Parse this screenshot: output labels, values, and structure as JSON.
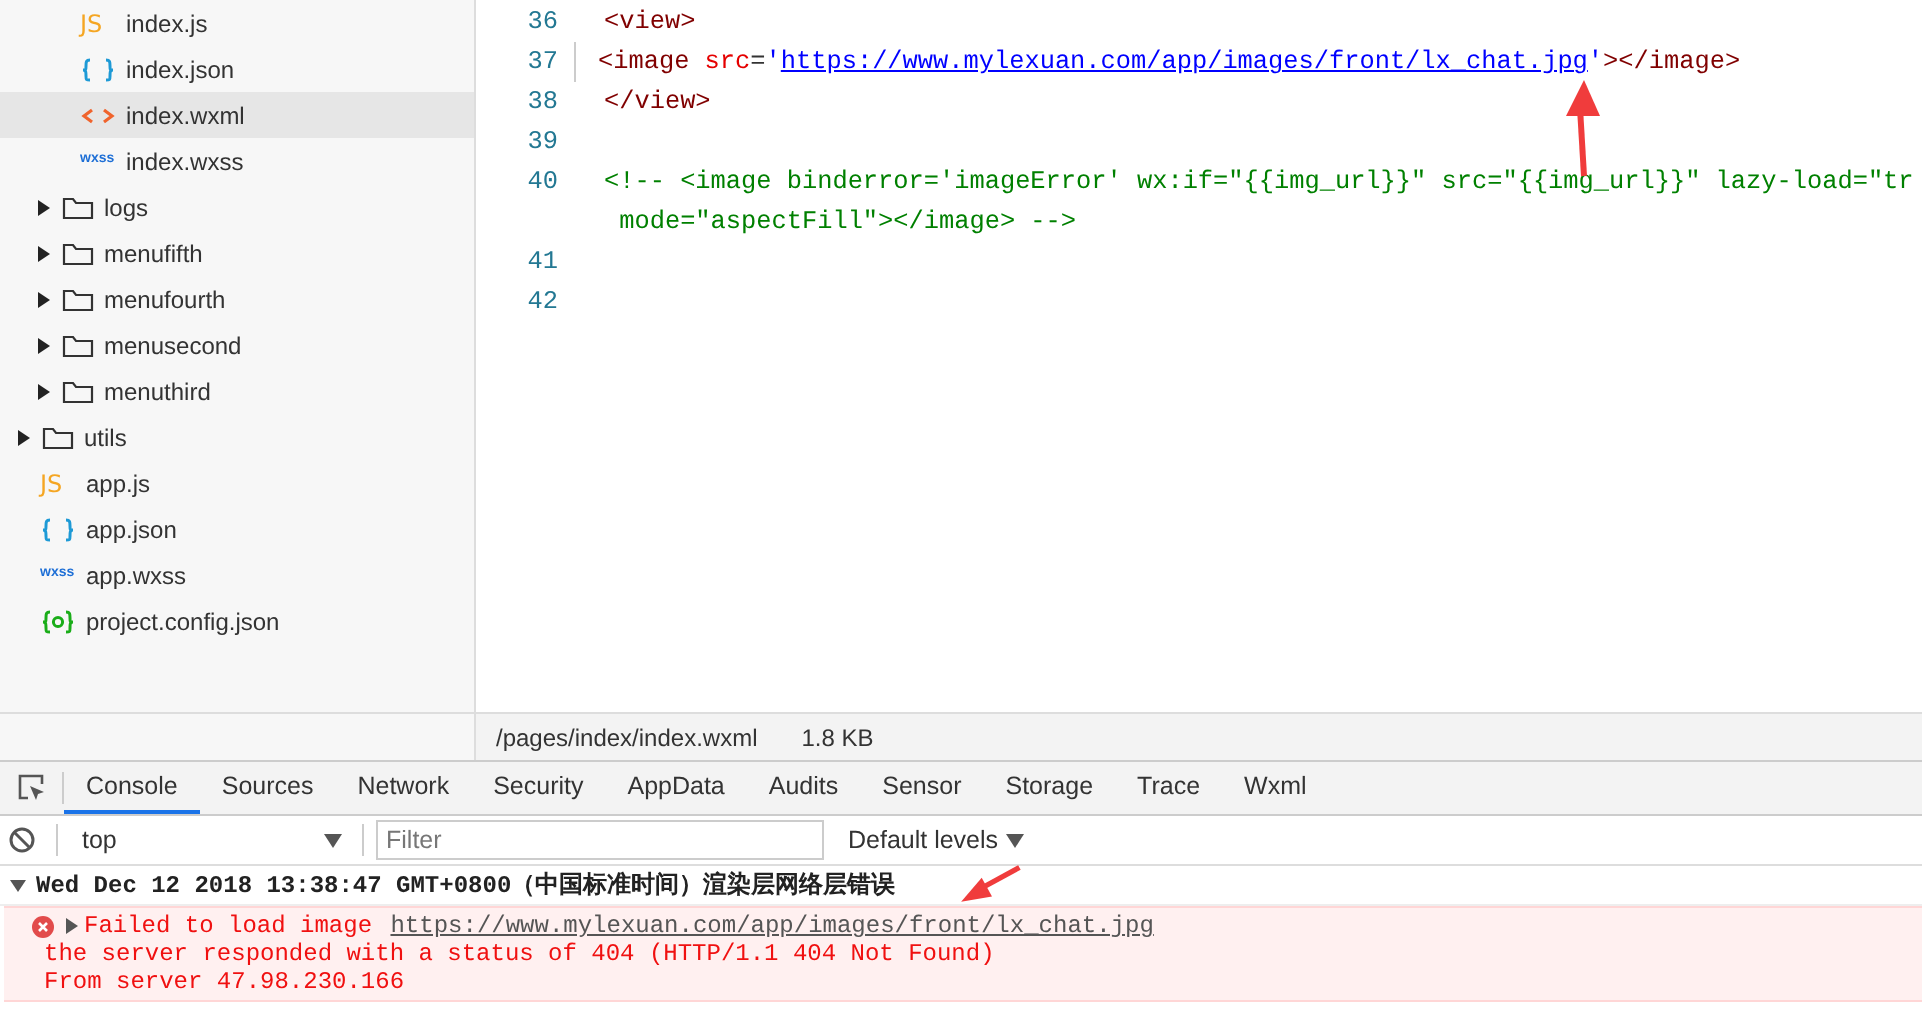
{
  "tree": [
    {
      "children": [
        {
          "children": [
            {
              "label": "index.js",
              "kind": "js",
              "icon_label": "JS",
              "selected": false
            },
            {
              "label": "index.json",
              "kind": "json",
              "selected": false
            },
            {
              "label": "index.wxml",
              "kind": "wxml",
              "selected": true
            },
            {
              "label": "index.wxss",
              "kind": "wxss",
              "icon_label": "wxss",
              "selected": false
            }
          ]
        },
        {
          "label": "logs",
          "kind": "folder",
          "expanded": false,
          "selected": false
        },
        {
          "label": "menufifth",
          "kind": "folder",
          "expanded": false,
          "selected": false
        },
        {
          "label": "menufourth",
          "kind": "folder",
          "expanded": false,
          "selected": false
        },
        {
          "label": "menusecond",
          "kind": "folder",
          "expanded": false,
          "selected": false
        },
        {
          "label": "menuthird",
          "kind": "folder",
          "expanded": false,
          "selected": false
        }
      ]
    },
    {
      "label": "utils",
      "kind": "folder",
      "expanded": false,
      "selected": false
    },
    {
      "label": "app.js",
      "kind": "js",
      "icon_label": "JS",
      "selected": false
    },
    {
      "label": "app.json",
      "kind": "json",
      "selected": false
    },
    {
      "label": "app.wxss",
      "kind": "wxss",
      "icon_label": "wxss",
      "selected": false
    },
    {
      "label": "project.config.json",
      "kind": "config",
      "selected": false
    }
  ],
  "editor": {
    "lines": [
      {
        "number": "36",
        "tokens": [
          {
            "kind": "tag",
            "text": "<view>"
          }
        ]
      },
      {
        "number": "37",
        "indent": true,
        "tokens": [
          {
            "kind": "tag",
            "text": "<image "
          },
          {
            "kind": "attr",
            "text": "src"
          },
          {
            "kind": "punct",
            "text": "="
          },
          {
            "kind": "string",
            "text": "'"
          },
          {
            "kind": "link",
            "text": "https://www.mylexuan.com/app/images/front/lx_chat.jpg"
          },
          {
            "kind": "string",
            "text": "'"
          },
          {
            "kind": "tag",
            "text": "></image>"
          }
        ]
      },
      {
        "number": "38",
        "tokens": [
          {
            "kind": "tag",
            "text": "</view>"
          }
        ]
      },
      {
        "number": "39"
      },
      {
        "number": "40",
        "tokens": [
          {
            "kind": "comment",
            "text": "<!-- <image binderror='imageError' wx:if=\"{{img_url}}\" src=\"{{img_url}}\" lazy-load=\"tr"
          }
        ],
        "wrapped": " mode=\"aspectFill\"></image> -->"
      },
      {
        "number": "41"
      },
      {
        "number": "42"
      }
    ]
  },
  "status_bar": {
    "path": "/pages/index/index.wxml",
    "size": "1.8 KB"
  },
  "devtools": {
    "tabs": [
      {
        "label": "Console",
        "selected": true
      },
      {
        "label": "Sources",
        "selected": false
      },
      {
        "label": "Network",
        "selected": false
      },
      {
        "label": "Security",
        "selected": false
      },
      {
        "label": "AppData",
        "selected": false
      },
      {
        "label": "Audits",
        "selected": false
      },
      {
        "label": "Sensor",
        "selected": false
      },
      {
        "label": "Storage",
        "selected": false
      },
      {
        "label": "Trace",
        "selected": false
      },
      {
        "label": "Wxml",
        "selected": false
      }
    ],
    "context": "top",
    "filter": {
      "placeholder": "Filter"
    },
    "levels": "Default levels",
    "messages": [
      {
        "kind": "group",
        "expanded": true,
        "text": "Wed Dec 12 2018 13:38:47 GMT+0800（中国标准时间）渲染层网络层错误"
      },
      {
        "kind": "error",
        "expanded": false,
        "text": "Failed to load image ",
        "link": "https://www.mylexuan.com/app/images/front/lx_chat.jpg",
        "details": [
          "the server responded with a status of 404 (HTTP/1.1 404 Not Found)",
          "From server 47.98.230.166"
        ]
      }
    ]
  }
}
